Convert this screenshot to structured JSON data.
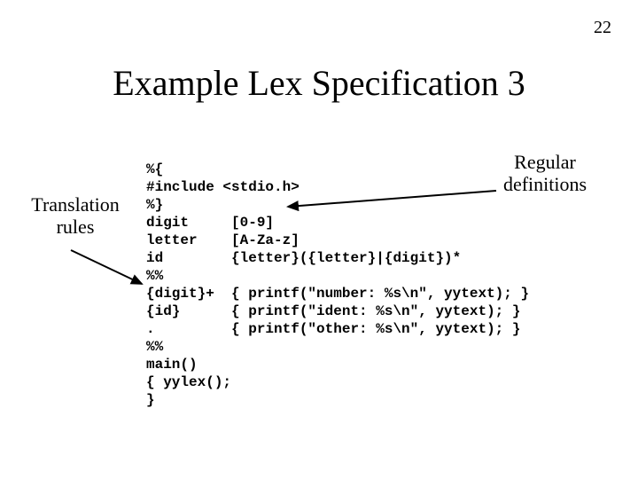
{
  "page_number": "22",
  "title": "Example Lex Specification 3",
  "labels": {
    "translation_rules": "Translation\nrules",
    "regular_definitions": "Regular\ndefinitions"
  },
  "code": "%{\n#include <stdio.h>\n%}\ndigit     [0-9]\nletter    [A-Za-z]\nid        {letter}({letter}|{digit})*\n%%\n{digit}+  { printf(\"number: %s\\n\", yytext); }\n{id}      { printf(\"ident: %s\\n\", yytext); }\n.         { printf(\"other: %s\\n\", yytext); }\n%%\nmain()\n{ yylex();\n}"
}
